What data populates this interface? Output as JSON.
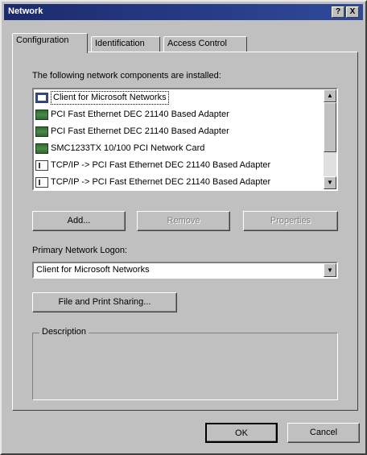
{
  "window": {
    "title": "Network",
    "help_label": "?",
    "close_label": "X"
  },
  "tabs": [
    {
      "label": "Configuration",
      "active": true
    },
    {
      "label": "Identification",
      "active": false
    },
    {
      "label": "Access Control",
      "active": false
    }
  ],
  "components": {
    "label": "The following network components are installed:",
    "items": [
      {
        "label": "Client for Microsoft Networks",
        "icon": "client-icon",
        "selected": true
      },
      {
        "label": "PCI Fast Ethernet DEC 21140 Based Adapter",
        "icon": "adapter-icon"
      },
      {
        "label": "PCI Fast Ethernet DEC 21140 Based Adapter",
        "icon": "adapter-icon"
      },
      {
        "label": "SMC1233TX 10/100 PCI Network Card",
        "icon": "adapter-icon"
      },
      {
        "label": "TCP/IP -> PCI Fast Ethernet DEC 21140 Based Adapter",
        "icon": "protocol-icon"
      },
      {
        "label": "TCP/IP -> PCI Fast Ethernet DEC 21140 Based Adapter",
        "icon": "protocol-icon"
      }
    ]
  },
  "buttons": {
    "add": "Add...",
    "remove": "Remove",
    "properties": "Properties",
    "file_print": "File and Print Sharing...",
    "ok": "OK",
    "cancel": "Cancel"
  },
  "logon": {
    "label": "Primary Network Logon:",
    "value": "Client for Microsoft Networks"
  },
  "description": {
    "label": "Description"
  },
  "colors": {
    "titlebar": "#1c2a6e",
    "face": "#c0c0c0"
  }
}
